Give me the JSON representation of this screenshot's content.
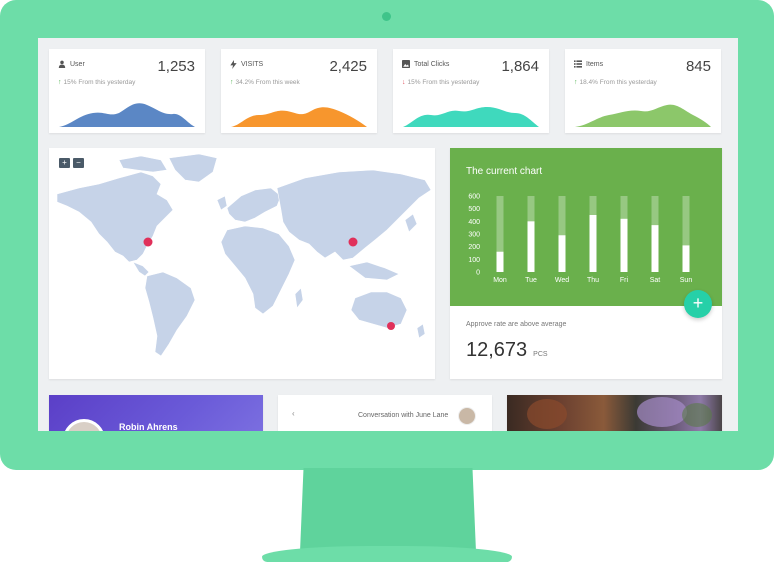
{
  "stats": [
    {
      "icon": "user-icon",
      "label": "User",
      "value": "1,253",
      "trend": "up",
      "delta": "15% From this yesterday",
      "color": "#5b87c5"
    },
    {
      "icon": "lightning-icon",
      "label": "VISITS",
      "value": "2,425",
      "trend": "up",
      "delta": "34.2% From this week",
      "color": "#f7962d"
    },
    {
      "icon": "image-icon",
      "label": "Total Clicks",
      "value": "1,864",
      "trend": "down",
      "delta": "15% From this yesterday",
      "color": "#3fd9bd"
    },
    {
      "icon": "list-icon",
      "label": "Items",
      "value": "845",
      "trend": "up",
      "delta": "18.4% From this yesterday",
      "color": "#8cc76a"
    }
  ],
  "map": {
    "zoom_in": "+",
    "zoom_out": "−",
    "marker_color": "#e0305a",
    "land_color": "#c6d3e8"
  },
  "current_chart": {
    "title": "The current chart",
    "approve_label": "Approve rate are above average",
    "approve_value": "12,673",
    "approve_unit": "PCS",
    "fab_label": "+"
  },
  "chart_data": {
    "type": "bar",
    "title": "The current chart",
    "categories": [
      "Mon",
      "Tue",
      "Wed",
      "Thu",
      "Fri",
      "Sat",
      "Sun"
    ],
    "values": [
      160,
      400,
      290,
      450,
      420,
      370,
      210
    ],
    "max_values": [
      600,
      600,
      600,
      600,
      600,
      600,
      600
    ],
    "yticks": [
      0,
      100,
      200,
      300,
      400,
      500,
      600
    ],
    "ylim": [
      0,
      600
    ],
    "xlabel": "",
    "ylabel": "",
    "grid": false
  },
  "profile": {
    "name": "Robin Ahrens"
  },
  "conversation": {
    "back": "‹",
    "title": "Conversation with June Lane"
  }
}
